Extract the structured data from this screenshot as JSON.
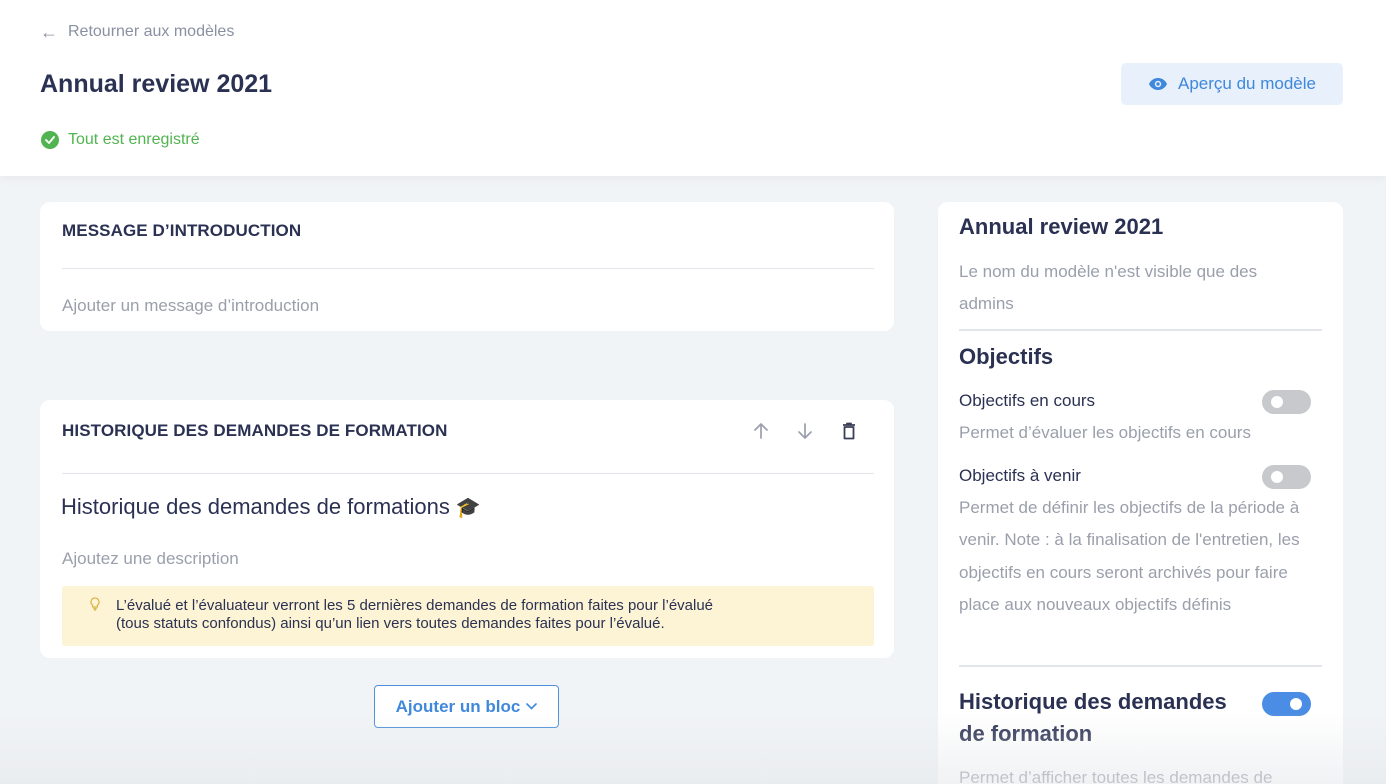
{
  "header": {
    "back_label": "Retourner aux modèles",
    "title": "Annual review 2021",
    "preview_label": "Aperçu du modèle",
    "saved_status": "Tout est enregistré"
  },
  "intro_block": {
    "heading": "MESSAGE D’INTRODUCTION",
    "placeholder": "Ajouter un message d’introduction"
  },
  "history_block": {
    "heading": "HISTORIQUE DES DEMANDES DE FORMATION",
    "title": "Historique des demandes de formations",
    "title_emoji": "🎓",
    "description_placeholder": "Ajoutez une description",
    "info_line1": "L’évalué et l’évaluateur verront les 5 dernières demandes de formation faites pour l’évalué",
    "info_line2": "(tous statuts confondus) ainsi qu’un lien vers toutes demandes faites pour l’évalué."
  },
  "add_block_label": "Ajouter un bloc",
  "side_panel": {
    "title": "Annual review 2021",
    "name_note": "Le nom du modèle n'est visible que des admins",
    "objectives_title": "Objectifs",
    "current_objectives": {
      "label": "Objectifs en cours",
      "description": "Permet d’évaluer les objectifs en cours",
      "enabled": false
    },
    "future_objectives": {
      "label": "Objectifs à venir",
      "description": "Permet de définir les objectifs de la période à venir. Note : à la finalisation de l'entretien, les objectifs en cours seront archivés pour faire place aux nouveaux objectifs définis",
      "enabled": false
    },
    "training_history": {
      "title": "Historique des demandes de formation",
      "description": "Permet d’afficher toutes les demandes de",
      "enabled": true
    }
  },
  "colors": {
    "accent": "#3f88db",
    "success": "#52b450",
    "toggle_on": "#4b8de4",
    "toggle_off": "#c8c9cd",
    "info_bg": "#fdf4d5"
  }
}
